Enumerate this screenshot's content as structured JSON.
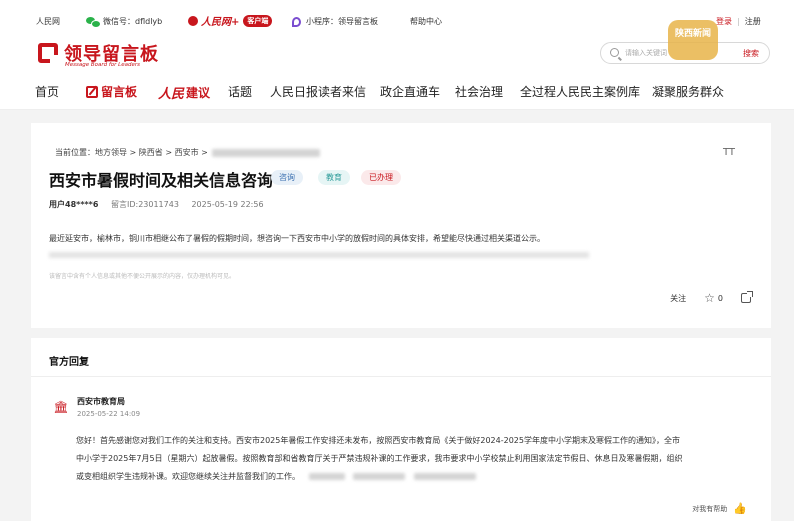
{
  "topbar": {
    "site": "人民网",
    "wechat": "微信号：dfldlyb",
    "rmw_logo": "人民网+",
    "rmw_badge": "客户端",
    "miniprogram": "小程序：领导留言板",
    "help": "帮助中心",
    "login": "登录",
    "sep": "|",
    "register": "注册"
  },
  "header": {
    "title": "领导留言板",
    "subtitle": "Message Board for Leaders",
    "search_placeholder": "请输入关键词",
    "search_btn": "搜索"
  },
  "watermark": "陕西新闻",
  "nav": {
    "home": "首页",
    "board": "留言板",
    "jianyi_logo": "人民",
    "jianyi": "建议",
    "topics": "话题",
    "letters": "人民日报读者来信",
    "zhengqi": "政企直通车",
    "social": "社会治理",
    "democracy": "全过程人民民主案例库",
    "service": "凝聚服务群众"
  },
  "message": {
    "breadcrumb": "当前位置：地方领导 > 陕西省 > 西安市 >",
    "font_icon": "TT",
    "title": "西安市暑假时间及相关信息咨询",
    "tags": {
      "type": "咨询",
      "field": "教育",
      "status": "已办理"
    },
    "user": "用户48****6",
    "msg_id": "留言ID:23011743",
    "time": "2025-05-19 22:56",
    "content": "最近延安市，榆林市，铜川市相继公布了暑假的假期时间，想咨询一下西安市中小学的放假时间的具体安排，希望能尽快通过相关渠道公示。",
    "notice": "该留言中含有个人信息或其他不便公开展示的内容，仅办理机构可见。",
    "follow": "关注",
    "like_count": "0"
  },
  "reply": {
    "heading": "官方回复",
    "org": "西安市教育局",
    "date": "2025-05-22 14:09",
    "line1": "您好！首先感谢您对我们工作的关注和支持。西安市2025年暑假工作安排还未发布，按照西安市教育局《关于做好2024-2025学年度中小学期末及寒假工作的通知》，全市",
    "line2": "中小学于2025年7月5日（星期六）起放暑假。按照教育部和省教育厅关于严禁违规补课的工作要求，我市要求中小学校禁止利用国家法定节假日、休息日及寒暑假期，组织",
    "line3": "或变相组织学生违规补课。欢迎您继续关注并监督我们的工作。",
    "helpful": "对我有帮助"
  }
}
